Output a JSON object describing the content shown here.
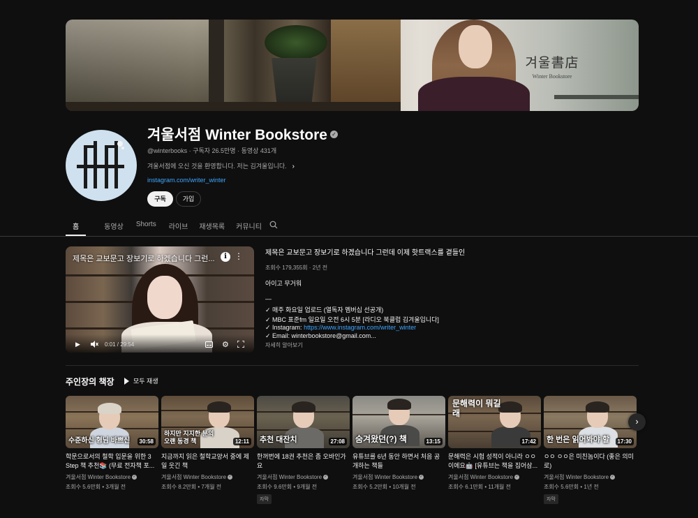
{
  "banner": {
    "logo_korean": "겨울書店",
    "logo_english": "Winter Bookstore"
  },
  "channel": {
    "name": "겨울서점 Winter Bookstore",
    "meta": "@winterbooks · 구독자 26.5만명 · 동영상 431개",
    "description": "겨울서점에 오신 것을 환영합니다. 저는 김겨울입니다.",
    "link": "instagram.com/writer_winter",
    "subscribe_label": "구독",
    "join_label": "가입"
  },
  "tabs": [
    "홈",
    "동영상",
    "Shorts",
    "라이브",
    "재생목록",
    "커뮤니티"
  ],
  "featured": {
    "thumb_title": "제목은 교보문고 장보기로 하겠습니다 그런...",
    "time": "0:01 / 29:54",
    "title": "제목은 교보문고 장보기로 하겠습니다 그런데 이제 핫트랙스를 곁들인",
    "meta": "조회수 179,355회 · 2년 전",
    "desc_line1": "아이고 무거워",
    "desc_sep": "—",
    "desc_line2": "✓ 매주 화요일 업로드 (열독자 멤버십 선공개)",
    "desc_line3": "✓ MBC 표준fm 일요일 오전 6시 5분 [라디오 북클럽 김겨울입니다]",
    "desc_line4_prefix": "✓ Instagram: ",
    "desc_line4_link": "https://www.instagram.com/writer_winter",
    "desc_line5": "✓ Email: winterbookstore@gmail.com...",
    "more": "자세히 알아보기"
  },
  "section": {
    "title": "주인장의 책장",
    "play_all": "모두 재생"
  },
  "videos": [
    {
      "caption": "수준하신 형님 바쁘신",
      "duration": "30:58",
      "title": "학문으로서의 철학 입문을 위한 3 Step 책 추천📚 (무료 전자책 포...",
      "channel": "겨울서점 Winter Bookstore",
      "meta": "조회수 5.6만회 • 3개월 전",
      "badge": ""
    },
    {
      "caption": "하지만 지지한 분의 오랜 동경 책",
      "duration": "12:11",
      "title": "지금까지 읽은 철학교양서 중에 제일 웃긴 책",
      "channel": "겨울서점 Winter Bookstore",
      "meta": "조회수 8.2만회 • 7개월 전",
      "badge": ""
    },
    {
      "caption": "추천 대잔치",
      "duration": "27:08",
      "title": "한꺼번에 18권 추천은 좀 오바인가요",
      "channel": "겨울서점 Winter Bookstore",
      "meta": "조회수 9.6만회 • 9개월 전",
      "badge": "자막"
    },
    {
      "caption": "숨겨왔던(?) 책",
      "duration": "13:15",
      "title": "유튜브를 6년 동안 하면서 처음 공개하는 책들",
      "channel": "겨울서점 Winter Bookstore",
      "meta": "조회수 5.2만회 • 10개월 전",
      "badge": ""
    },
    {
      "caption": "문해력이 뭐길래",
      "duration": "17:42",
      "title": "문해력은 시험 성적이 아니라 ㅇㅇ이에요🤖 [유튜브는 책을 집어삼...",
      "channel": "겨울서점 Winter Bookstore",
      "meta": "조회수 6.1만회 • 11개월 전",
      "badge": ""
    },
    {
      "caption": "한 번은 읽어봐야 할",
      "duration": "17:30",
      "title": "ㅇㅇ ㅇㅇ은 미친놈이다 (좋은 의미로)",
      "channel": "겨울서점 Winter Bookstore",
      "meta": "조회수 5.6만회 • 1년 전",
      "badge": "자막"
    }
  ]
}
